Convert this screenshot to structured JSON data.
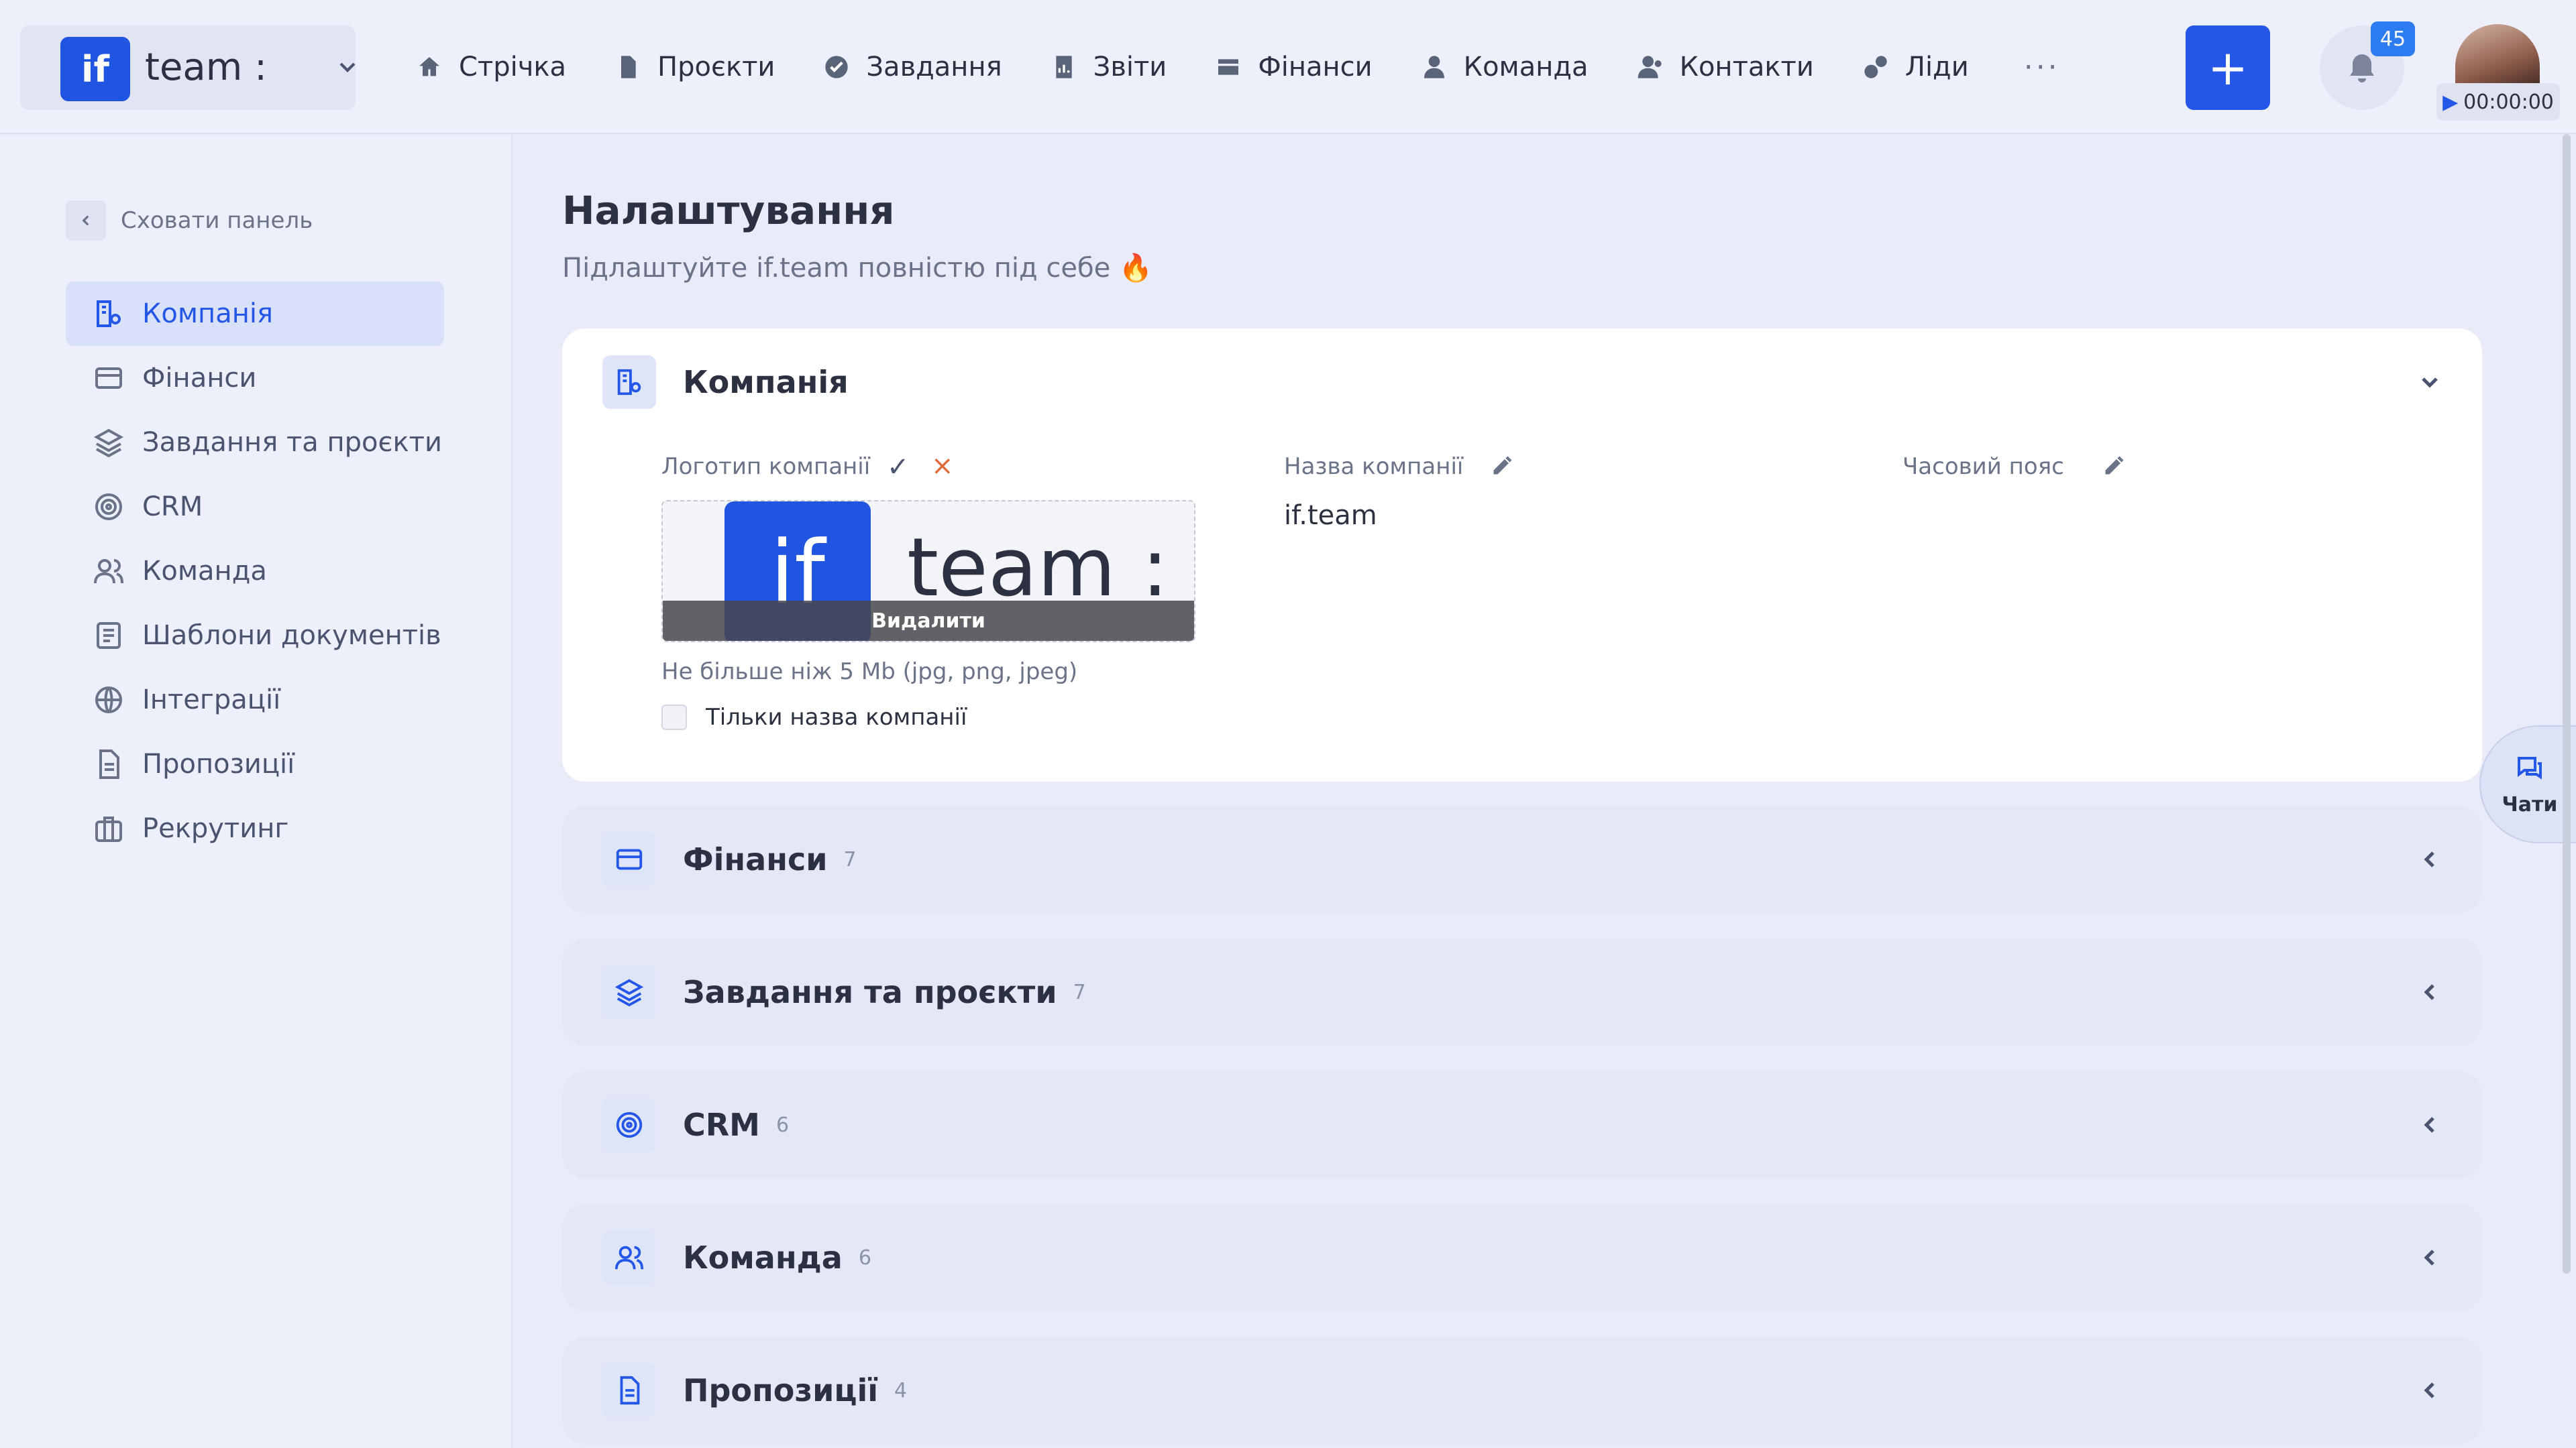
{
  "workspace": {
    "logo_text": "if",
    "name": "team :"
  },
  "nav": [
    {
      "icon": "home-icon",
      "label": "Стрічка"
    },
    {
      "icon": "file-icon",
      "label": "Проєкти"
    },
    {
      "icon": "check-circle-icon",
      "label": "Завдання"
    },
    {
      "icon": "report-icon",
      "label": "Звіти"
    },
    {
      "icon": "wallet-icon",
      "label": "Фінанси"
    },
    {
      "icon": "user-icon",
      "label": "Команда"
    },
    {
      "icon": "contacts-icon",
      "label": "Контакти"
    },
    {
      "icon": "leads-icon",
      "label": "Ліди"
    }
  ],
  "nav_more": "···",
  "topbar": {
    "plus": "+",
    "notifications": "45",
    "timer": "00:00:00"
  },
  "sidebar": {
    "hide_label": "Сховати панель",
    "items": [
      {
        "icon": "company-settings-icon",
        "label": "Компанія",
        "active": true
      },
      {
        "icon": "card-icon",
        "label": "Фінанси"
      },
      {
        "icon": "layers-icon",
        "label": "Завдання та проєкти"
      },
      {
        "icon": "target-icon",
        "label": "CRM"
      },
      {
        "icon": "team-icon",
        "label": "Команда"
      },
      {
        "icon": "doc-template-icon",
        "label": "Шаблони документів"
      },
      {
        "icon": "globe-icon",
        "label": "Інтеграції"
      },
      {
        "icon": "proposal-icon",
        "label": "Пропозиції"
      },
      {
        "icon": "briefcase-icon",
        "label": "Рекрутинг"
      }
    ]
  },
  "page": {
    "title": "Налаштування",
    "subtitle": "Підлаштуйте if.team повністю під себе 🔥"
  },
  "company_card": {
    "title": "Компанія",
    "logo_label": "Логотип компанії",
    "logo_if": "if",
    "logo_team": "team :",
    "logo_delete": "Видалити",
    "logo_hint": "Не більше ніж 5 Mb (jpg, png, jpeg)",
    "only_name_label": "Тільки назва компанії",
    "name_label": "Назва компанії",
    "name_value": "if.team",
    "timezone_label": "Часовий пояс"
  },
  "sections": [
    {
      "icon": "card-icon",
      "title": "Фінанси",
      "count": "7"
    },
    {
      "icon": "layers-icon",
      "title": "Завдання та проєкти",
      "count": "7"
    },
    {
      "icon": "target-icon",
      "title": "CRM",
      "count": "6"
    },
    {
      "icon": "team-icon",
      "title": "Команда",
      "count": "6"
    },
    {
      "icon": "proposal-icon",
      "title": "Пропозиції",
      "count": "4"
    }
  ],
  "chat": {
    "label": "Чати"
  },
  "colors": {
    "accent": "#2457e8",
    "background": "#e9ecf8",
    "card": "#ffffff"
  }
}
